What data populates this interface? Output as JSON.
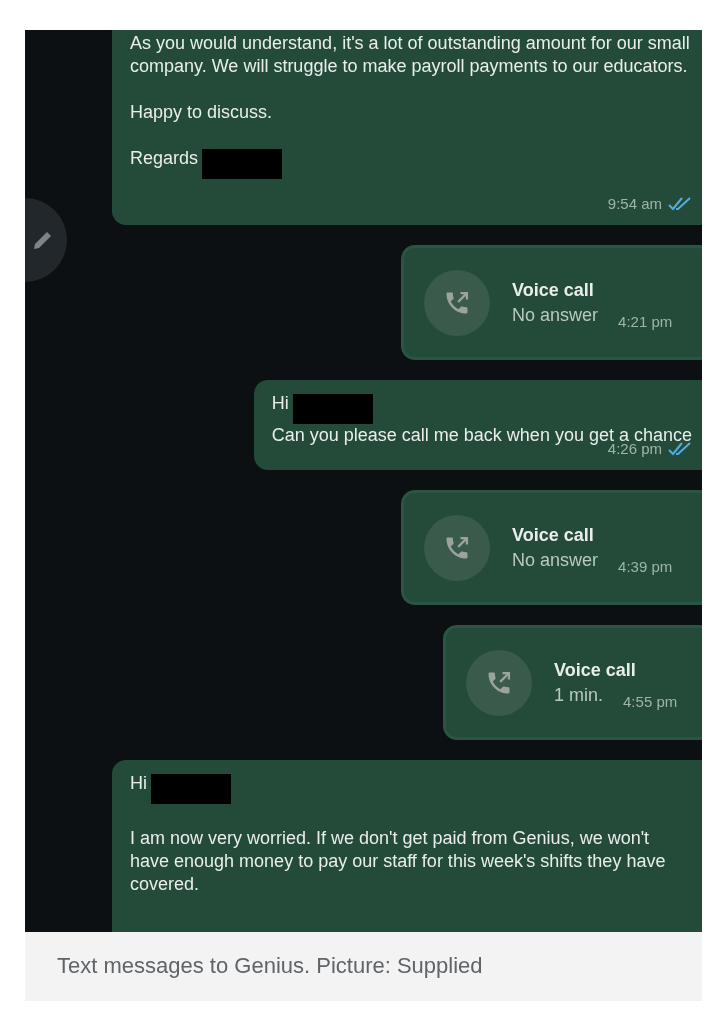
{
  "chat": {
    "messages": [
      {
        "kind": "text",
        "spaced": true,
        "paragraphs": [
          {
            "text": "As you would understand, it's a lot of outstanding amount for our small company. We will struggle to make payroll payments to our educators.",
            "redacted": false
          },
          {
            "text": "Happy to discuss.",
            "redacted": false
          },
          {
            "text": "Regards",
            "redacted": true
          }
        ],
        "time": "9:54 am",
        "read": true
      },
      {
        "kind": "call",
        "title": "Voice call",
        "detail": "No answer",
        "time": "4:21 pm"
      },
      {
        "kind": "text",
        "spaced": false,
        "paragraphs": [
          {
            "text": "Hi",
            "redacted": true
          },
          {
            "text": "Can you please call me back when you get a chance",
            "redacted": false
          }
        ],
        "time": "4:26 pm",
        "read": true
      },
      {
        "kind": "call",
        "title": "Voice call",
        "detail": "No answer",
        "time": "4:39 pm"
      },
      {
        "kind": "call",
        "title": "Voice call",
        "detail": "1 min.",
        "time": "4:55 pm"
      },
      {
        "kind": "text",
        "spaced": true,
        "paragraphs": [
          {
            "text": "Hi",
            "redacted": true
          },
          {
            "text": "I am now very worried. If we don't get paid from Genius, we won't have enough money to pay our staff for this week's shifts they have covered.",
            "redacted": false
          }
        ]
      }
    ]
  },
  "caption": "Text messages to Genius. Picture: Supplied"
}
